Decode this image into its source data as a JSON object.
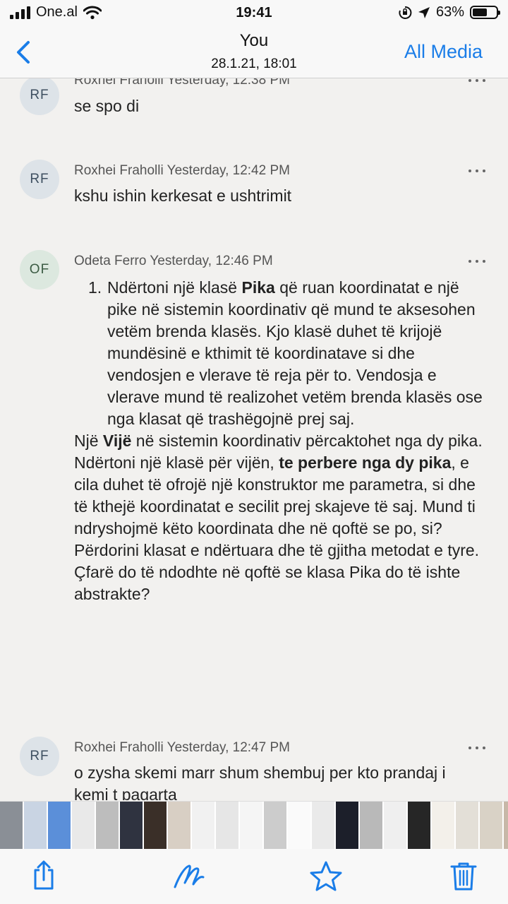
{
  "status": {
    "carrier": "One.al",
    "time": "19:41",
    "battery_percent": "63%",
    "battery_level": 0.63
  },
  "nav": {
    "title": "You",
    "subtitle": "28.1.21, 18:01",
    "all_media": "All Media"
  },
  "messages": [
    {
      "initials": "RF",
      "sender": "Roxhei Fraholli",
      "time": "Yesterday, 12:38 PM",
      "text": "se spo di"
    },
    {
      "initials": "RF",
      "sender": "Roxhei Fraholli",
      "time": "Yesterday, 12:42 PM",
      "text": "kshu ishin kerkesat e ushtrimit"
    },
    {
      "initials": "OF",
      "sender": "Odeta Ferro",
      "time": "Yesterday, 12:46 PM",
      "list_number": "1.",
      "item1": {
        "t1": "Ndërtoni një klasë ",
        "b1": "Pika",
        "t2": " që ruan koordinatat e një pike në sistemin koordinativ që mund te aksesohen vetëm brenda klasës. Kjo klasë duhet të krijojë mundësinë e kthimit të koordinatave si dhe vendosjen e vlerave të reja për to. Vendosja e vlerave mund të realizohet vetëm brenda klasës ose nga klasat që trashëgojnë prej saj."
      },
      "para1": {
        "t1": "Një ",
        "b1": "Vijë",
        "t2": " në sistemin koordinativ përcaktohet nga dy pika. Ndërtoni një klasë për vijën, ",
        "b2": "te perbere nga dy pika",
        "t3": ", e cila duhet të ofrojë një konstruktor me parametra, si dhe të kthejë koordinatat e secilit prej skajeve të saj. Mund ti ndryshojmë këto koordinata dhe në qoftë se po, si?"
      },
      "para2": "Përdorini klasat e ndërtuara dhe të gjitha metodat e tyre.",
      "para3": "Çfarë do të ndodhte në qoftë se klasa Pika do të ishte abstrakte?"
    },
    {
      "initials": "RF",
      "sender": "Roxhei Fraholli",
      "time": "Yesterday, 12:47 PM",
      "text": "o zysha skemi marr shum shembuj per kto prandaj i kemi t pagarta"
    }
  ],
  "thumbnails": [
    "#8a8f96",
    "#c9d4e3",
    "#5b8fd9",
    "#e9e9e9",
    "#bdbdbd",
    "#2f3340",
    "#3a2f28",
    "#d8cfc4",
    "#f1f1f1",
    "#e6e6e6",
    "#f5f5f5",
    "#cccccc",
    "#fafafa",
    "#eaeaea",
    "#1c1f2a",
    "#b9b9b9",
    "#efefef",
    "#262626",
    "#f3f0ea",
    "#e3dfd7",
    "#d9d2c6",
    "#c7b8a8",
    "#f2efe9",
    "#ddd8cf",
    "#cfc6b9",
    "#e8e3db",
    "#bcb4a8",
    "#a59d92",
    "#f4f1ec",
    "#9e978d"
  ],
  "toolbar": [
    "share-icon",
    "markup-icon",
    "favorite-star-icon",
    "trash-icon"
  ],
  "colors": {
    "accent": "#1a7de8",
    "background": "#f2f1ef"
  }
}
